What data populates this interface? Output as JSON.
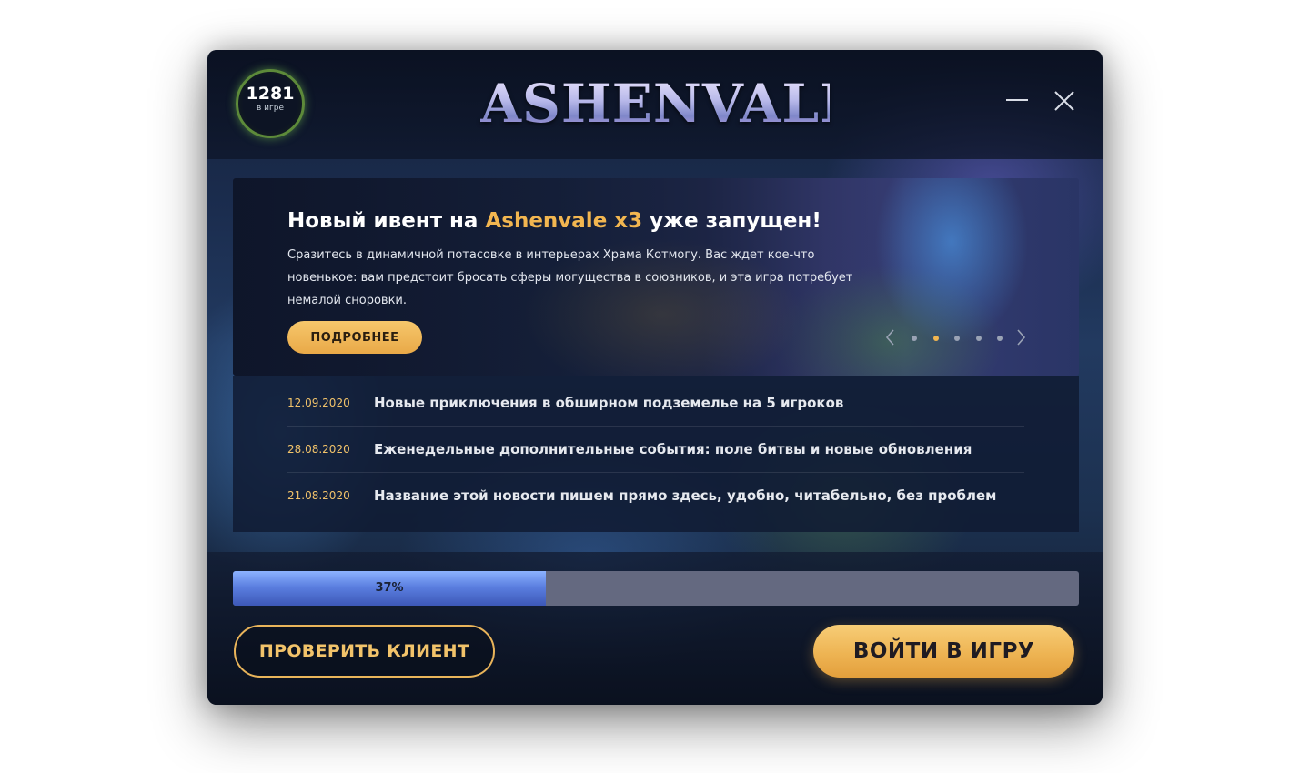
{
  "online": {
    "count": "1281",
    "label": "в игре"
  },
  "header": {
    "logo_text": "ASHENVALE"
  },
  "hero": {
    "title_prefix": "Новый ивент на ",
    "title_accent": "Ashenvale x3",
    "title_suffix": " уже запущен!",
    "text": "Сразитесь в динамичной потасовке в интерьерах Храма Котмогу. Вас ждет кое-что новенькое: вам предстоит бросать сферы могущества в союзников, и эта игра потребует немалой сноровки.",
    "more_label": "ПОДРОБНЕЕ",
    "slides_total": 5,
    "active_slide": 2
  },
  "news": [
    {
      "date": "12.09.2020",
      "title": "Новые приключения в обширном подземелье на 5 игроков"
    },
    {
      "date": "28.08.2020",
      "title": "Еженедельные дополнительные события: поле битвы и новые обновления"
    },
    {
      "date": "21.08.2020",
      "title": "Название этой новости пишем прямо здесь, удобно, читабельно, без проблем"
    }
  ],
  "progress": {
    "percent_label": "37%",
    "fraction": 0.37
  },
  "actions": {
    "check_label": "ПРОВЕРИТЬ КЛИЕНТ",
    "play_label": "ВОЙТИ В ИГРУ"
  },
  "colors": {
    "accent": "#f2b650",
    "progress": "#5b7fe0",
    "online_ring": "#5d8a3a"
  }
}
